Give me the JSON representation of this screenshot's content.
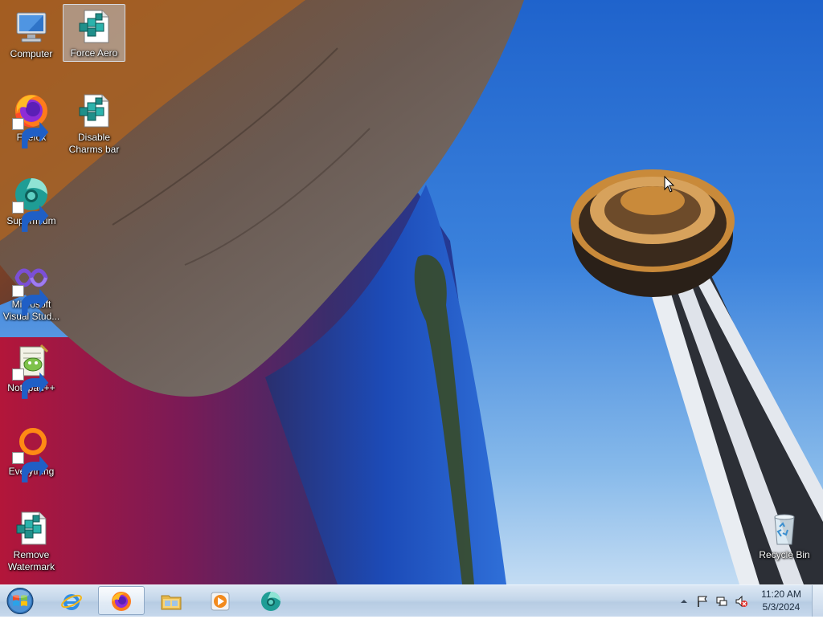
{
  "desktop": {
    "icons": [
      {
        "label": "Computer",
        "icon": "computer-icon"
      },
      {
        "label": "Force Aero",
        "icon": "registry-file-icon",
        "selected": true
      },
      {
        "label": "Firefox",
        "icon": "firefox-icon",
        "shortcut": true
      },
      {
        "label": "Disable Charms bar",
        "icon": "registry-file-icon"
      },
      {
        "label": "Supermium",
        "icon": "supermium-icon",
        "shortcut": true
      },
      {
        "label": "Microsoft Visual Stud...",
        "icon": "visual-studio-icon",
        "shortcut": true
      },
      {
        "label": "Notepad++",
        "icon": "notepadpp-icon",
        "shortcut": true
      },
      {
        "label": "Everything",
        "icon": "everything-icon",
        "shortcut": true
      },
      {
        "label": "Remove Watermark",
        "icon": "registry-file-icon"
      },
      {
        "label": "Recycle Bin",
        "icon": "recycle-bin-icon"
      }
    ]
  },
  "taskbar": {
    "start": "windows-start-orb",
    "pinned": [
      {
        "name": "Internet Explorer",
        "icon": "internet-explorer-icon"
      },
      {
        "name": "Firefox",
        "icon": "firefox-icon",
        "active": true
      },
      {
        "name": "Windows Explorer",
        "icon": "folder-icon"
      },
      {
        "name": "Windows Media Player",
        "icon": "media-player-icon"
      },
      {
        "name": "Supermium",
        "icon": "supermium-icon"
      }
    ],
    "tray": {
      "icons": [
        "show-hidden-icons-chevron",
        "action-center-flag-icon",
        "network-icon",
        "volume-muted-icon"
      ],
      "time": "11:20 AM",
      "date": "5/3/2024"
    }
  },
  "colors": {
    "accent": "#3f86de",
    "taskbar": "#c4d6ea",
    "icon_label": "#ffffff"
  }
}
